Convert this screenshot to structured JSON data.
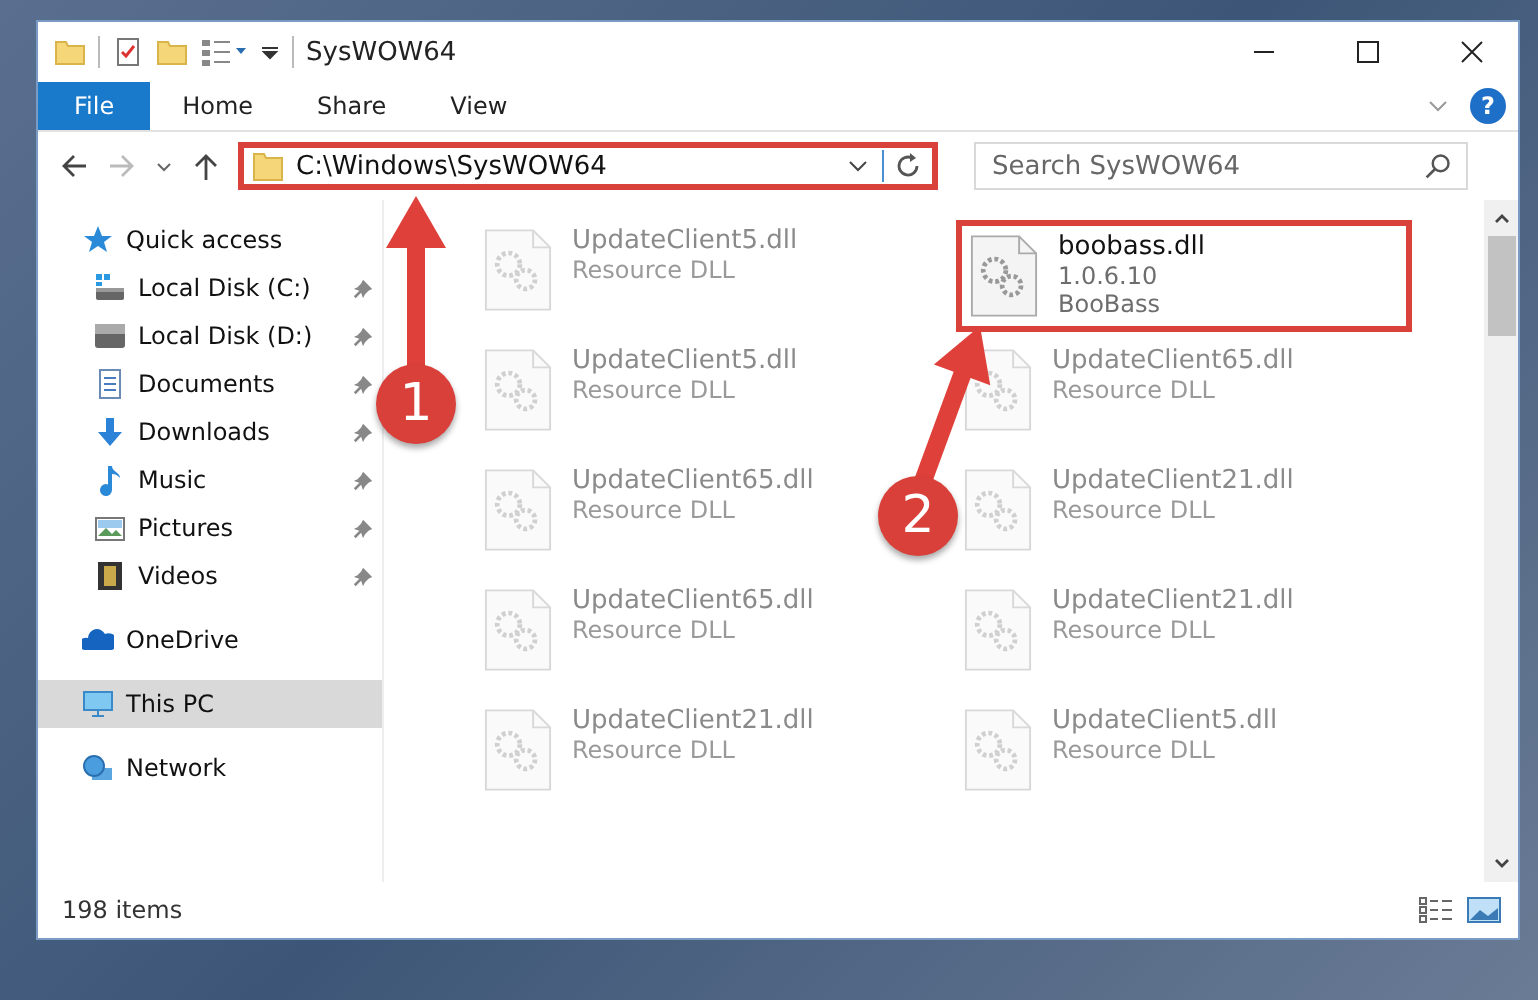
{
  "window": {
    "title": "SysWOW64"
  },
  "help_button": {
    "label": "?"
  },
  "ribbon_tabs": [
    {
      "label": "File",
      "selected": true
    },
    {
      "label": "Home",
      "selected": false
    },
    {
      "label": "Share",
      "selected": false
    },
    {
      "label": "View",
      "selected": false
    }
  ],
  "address": {
    "path": "C:\\Windows\\SysWOW64",
    "highlighted": true
  },
  "search": {
    "placeholder": "Search SysWOW64"
  },
  "sidebar": {
    "items": [
      {
        "label": "Quick access",
        "selected": false,
        "children": [
          {
            "label": "Local Disk (C:)",
            "pinned": true,
            "selected": false
          },
          {
            "label": "Local Disk (D:)",
            "pinned": true,
            "selected": false
          },
          {
            "label": "Documents",
            "pinned": true,
            "selected": false
          },
          {
            "label": "Downloads",
            "pinned": true,
            "selected": false
          },
          {
            "label": "Music",
            "pinned": true,
            "selected": false
          },
          {
            "label": "Pictures",
            "pinned": true,
            "selected": false
          },
          {
            "label": "Videos",
            "pinned": true,
            "selected": false
          }
        ]
      },
      {
        "label": "OneDrive",
        "selected": false
      },
      {
        "label": "This PC",
        "selected": true
      },
      {
        "label": "Network",
        "selected": false
      }
    ]
  },
  "files": [
    {
      "name": "UpdateClient5.dll",
      "details": [
        "Resource DLL"
      ],
      "faded": true,
      "highlighted": false
    },
    {
      "name": "boobass.dll",
      "details": [
        "1.0.6.10",
        "BooBass"
      ],
      "faded": false,
      "highlighted": true
    },
    {
      "name": "UpdateClient5.dll",
      "details": [
        "Resource DLL"
      ],
      "faded": true,
      "highlighted": false
    },
    {
      "name": "UpdateClient65.dll",
      "details": [
        "Resource DLL"
      ],
      "faded": true,
      "highlighted": false
    },
    {
      "name": "UpdateClient65.dll",
      "details": [
        "Resource DLL"
      ],
      "faded": true,
      "highlighted": false
    },
    {
      "name": "UpdateClient21.dll",
      "details": [
        "Resource DLL"
      ],
      "faded": true,
      "highlighted": false
    },
    {
      "name": "UpdateClient65.dll",
      "details": [
        "Resource DLL"
      ],
      "faded": true,
      "highlighted": false
    },
    {
      "name": "UpdateClient21.dll",
      "details": [
        "Resource DLL"
      ],
      "faded": true,
      "highlighted": false
    },
    {
      "name": "UpdateClient21.dll",
      "details": [
        "Resource DLL"
      ],
      "faded": true,
      "highlighted": false
    },
    {
      "name": "UpdateClient5.dll",
      "details": [
        "Resource DLL"
      ],
      "faded": true,
      "highlighted": false
    }
  ],
  "annotations": [
    {
      "number": "1"
    },
    {
      "number": "2"
    }
  ],
  "status_bar": {
    "item_count": "198 items"
  }
}
